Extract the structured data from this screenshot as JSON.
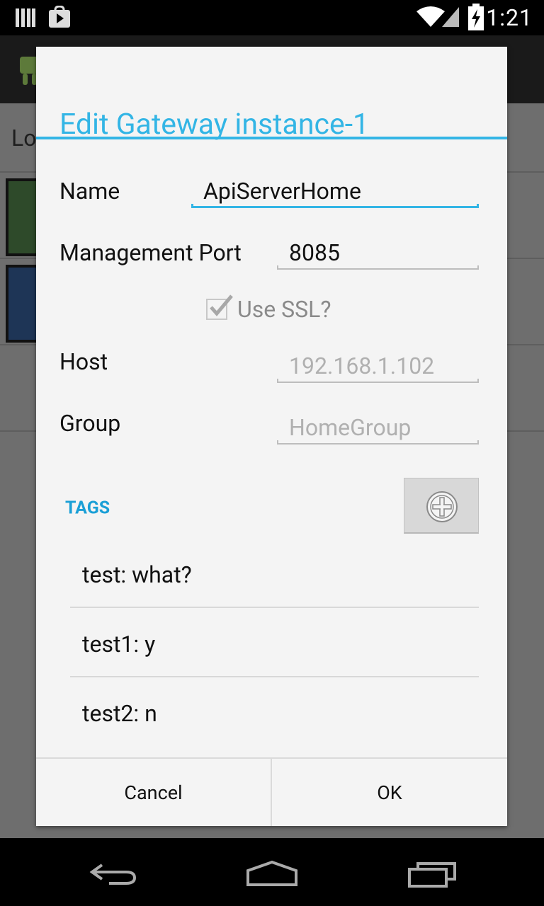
{
  "status_bar": {
    "time": "1:21",
    "icons": [
      "notification-bars-icon",
      "play-store-icon",
      "wifi-icon",
      "signal-icon",
      "battery-charging-icon"
    ]
  },
  "background_app": {
    "visible_title_fragment": "Lo",
    "tile_colors": [
      "#2e4a2a",
      "#1e3556"
    ]
  },
  "dialog": {
    "title": "Edit Gateway instance-1",
    "fields": {
      "name": {
        "label": "Name",
        "value": "ApiServerHome"
      },
      "management_port": {
        "label": "Management Port",
        "value": "8085"
      },
      "use_ssl": {
        "label": "Use SSL?",
        "checked": true,
        "enabled": false
      },
      "host": {
        "label": "Host",
        "placeholder": "192.168.1.102"
      },
      "group": {
        "label": "Group",
        "placeholder": "HomeGroup"
      }
    },
    "tags": {
      "header": "TAGS",
      "add_icon": "add-circle-icon",
      "items": [
        "test: what?",
        "test1: y",
        "test2: n"
      ]
    },
    "buttons": {
      "cancel": "Cancel",
      "ok": "OK"
    }
  },
  "colors": {
    "accent": "#33b5e5",
    "tags_header": "#1a9fd6",
    "dialog_bg": "#f4f4f4"
  },
  "nav_bar": {
    "icons": [
      "back-icon",
      "home-icon",
      "recents-icon"
    ]
  }
}
